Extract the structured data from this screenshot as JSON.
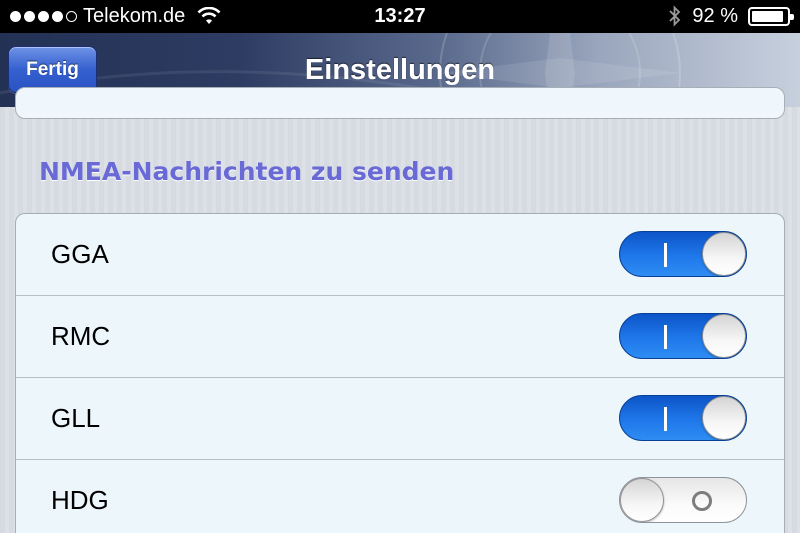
{
  "status_bar": {
    "signal_bars_filled": 4,
    "signal_bars_total": 5,
    "carrier": "Telekom.de",
    "wifi_icon": "wifi-icon",
    "time": "13:27",
    "bluetooth_icon": "bluetooth-icon",
    "battery_percent_label": "92 %",
    "battery_level": 0.92
  },
  "nav": {
    "title": "Einstellungen",
    "done_button_label": "Fertig",
    "accent_color": "#3560cf"
  },
  "section": {
    "header": "NMEA-Nachrichten zu senden",
    "header_color": "#6a6ad6",
    "rows": [
      {
        "label": "GGA",
        "enabled": true
      },
      {
        "label": "RMC",
        "enabled": true
      },
      {
        "label": "GLL",
        "enabled": true
      },
      {
        "label": "HDG",
        "enabled": false
      }
    ]
  }
}
